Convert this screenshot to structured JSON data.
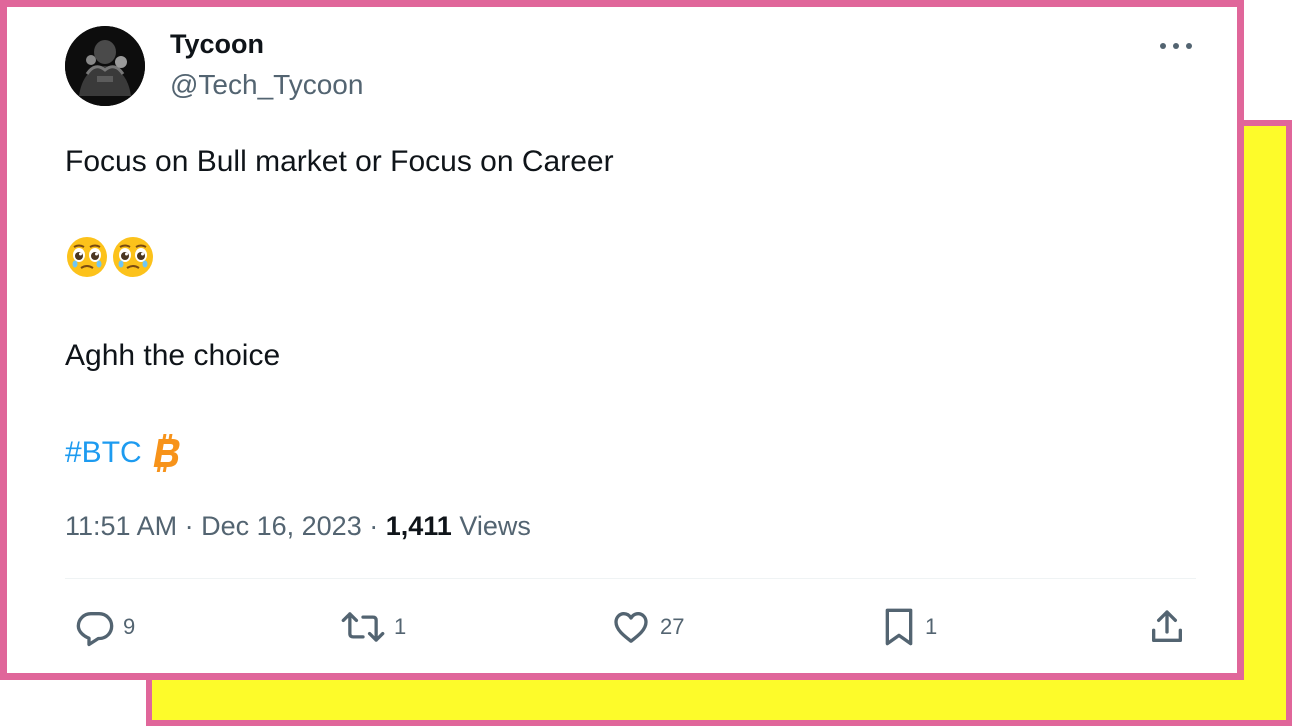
{
  "tweet": {
    "display_name": "Tycoon",
    "handle": "@Tech_Tycoon",
    "text_line_1": "Focus on Bull market or Focus on Career",
    "emoji": [
      "🥹",
      "🥹"
    ],
    "text_line_2": "Aghh the choice",
    "hashtag": "#BTC",
    "hashtag_emoji": "bitcoin-icon",
    "time": "11:51 AM",
    "date": "Dec 16, 2023",
    "views_count": "1,411",
    "views_label": "Views"
  },
  "actions": {
    "replies": "9",
    "reposts": "1",
    "likes": "27",
    "bookmarks": "1"
  },
  "colors": {
    "frame": "#e0669a",
    "yellow": "#fdfb2a",
    "link": "#1d9bf0",
    "muted": "#536471",
    "bitcoin": "#f7931a"
  }
}
